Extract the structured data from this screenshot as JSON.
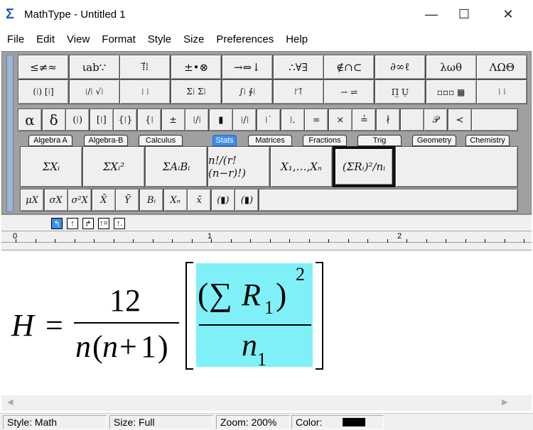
{
  "window": {
    "title": "MathType - Untitled 1",
    "minimize": "—",
    "maximize": "☐",
    "close": "✕"
  },
  "menu": [
    "File",
    "Edit",
    "View",
    "Format",
    "Style",
    "Size",
    "Preferences",
    "Help"
  ],
  "palette_row1": [
    "≤≠≈",
    "⍳ab∵",
    "⁞⃗⁞",
    "±•⊗",
    "→⇔↓",
    "∴∀∃",
    "∉∩⊂",
    "∂∞ℓ",
    "λωθ",
    "ΛΩΘ"
  ],
  "palette_row2": [
    "(⁞) [⁞]",
    "⁞/⁞ √⁞",
    "⁞ ⁞",
    "Σ⁞ Σ⁞",
    "∫⁞ ∮⁞",
    "⁞̄ ⁞⃗",
    "⇀ ⇌",
    "Π̲ Ụ",
    "▫▫▫ ▦",
    "⁞ ⁞"
  ],
  "symbol_row": [
    "α",
    "δ",
    "(⁞)",
    "[⁞]",
    "{⁞}",
    "{⁞",
    "±",
    "⁞/⁞",
    "▮",
    "⁞/⁞",
    "⁞˙",
    "⁞.",
    "∞",
    "×",
    "≟",
    "∤",
    "",
    "𝒫",
    "≺",
    ""
  ],
  "tabs": [
    "Algebra A",
    "Algebra-B",
    "Calculus",
    "Stats",
    "Matrices",
    "Fractions",
    "Trig",
    "Geometry",
    "Chemistry"
  ],
  "active_tab": "Stats",
  "templates": [
    "ΣXᵢ",
    "ΣXᵢ²",
    "ΣAᵢBᵢ",
    "n!/(r!(n−r)!)",
    "X₁,…,Xₙ",
    "(ΣRᵢ)²/nᵢ"
  ],
  "small_templates": [
    "μX",
    "σX",
    "σ²X",
    "X̄",
    "Ȳ",
    "Bᵢ",
    "Xₙ",
    "x̄",
    "(▮)",
    "(▮)"
  ],
  "tab_stops": [
    "↰",
    "↑",
    "↱",
    "↑=",
    "↑."
  ],
  "ruler_labels": [
    "0",
    "1",
    "2"
  ],
  "equation": {
    "lhs": "H",
    "eq": "=",
    "num": "12",
    "den_n": "n",
    "den_open": "(",
    "den_n2": "n",
    "den_plus": "+",
    "den_one": "1",
    "den_close": ")",
    "sigma": "∑",
    "R": "R",
    "sub1": "1",
    "sq": "2",
    "n": "n",
    "nsub": "1"
  },
  "status": {
    "style": "Style: Math",
    "size": "Size: Full",
    "zoom": "Zoom: 200%",
    "color": "Color:"
  },
  "colors": {
    "accent": "#3c8ef0",
    "selection": "#7ff0f8",
    "swatch": "#000000"
  }
}
